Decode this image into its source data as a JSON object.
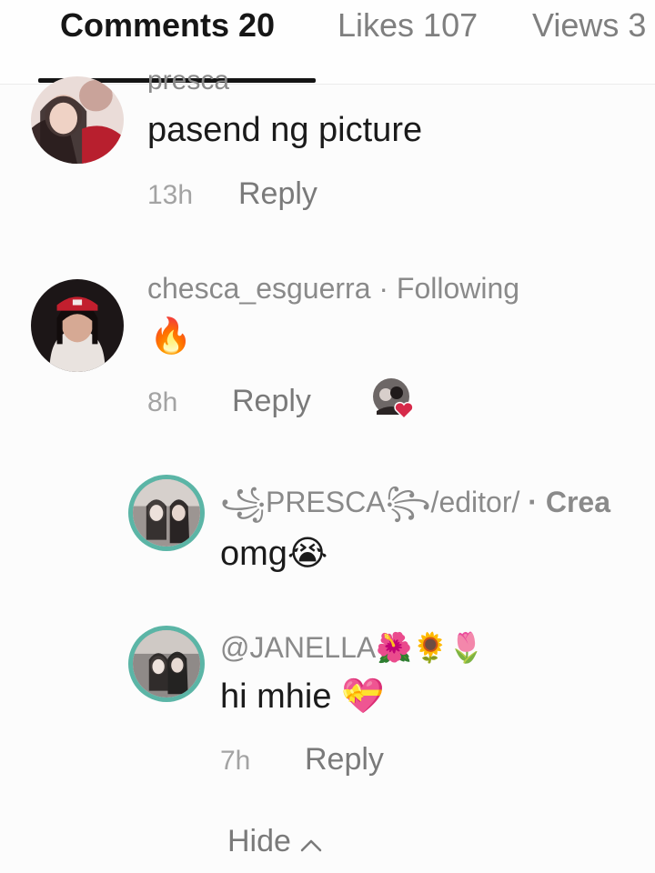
{
  "tabs": [
    {
      "label": "Comments 20"
    },
    {
      "label": "Likes 107"
    },
    {
      "label": "Views 3"
    }
  ],
  "comments": [
    {
      "username_partial": "presca",
      "text": "pasend ng picture",
      "time": "13h",
      "reply": "Reply"
    },
    {
      "username": "chesca_esguerra",
      "relation": "· Following",
      "text": "🔥",
      "time": "8h",
      "reply": "Reply"
    }
  ],
  "replies": [
    {
      "username": "꧁PRESCA꧂/editor/",
      "tag": "· Crea",
      "text": "omg😭"
    },
    {
      "username": "@JANELLA🌺🌻🌷",
      "text": "hi mhie 💝",
      "time": "7h",
      "reply": "Reply"
    }
  ],
  "hide_label": "Hide",
  "colors": {
    "accent_ring": "#5bb5a6",
    "creator_tag": "#2f7f76",
    "heart": "#d62a4a"
  }
}
